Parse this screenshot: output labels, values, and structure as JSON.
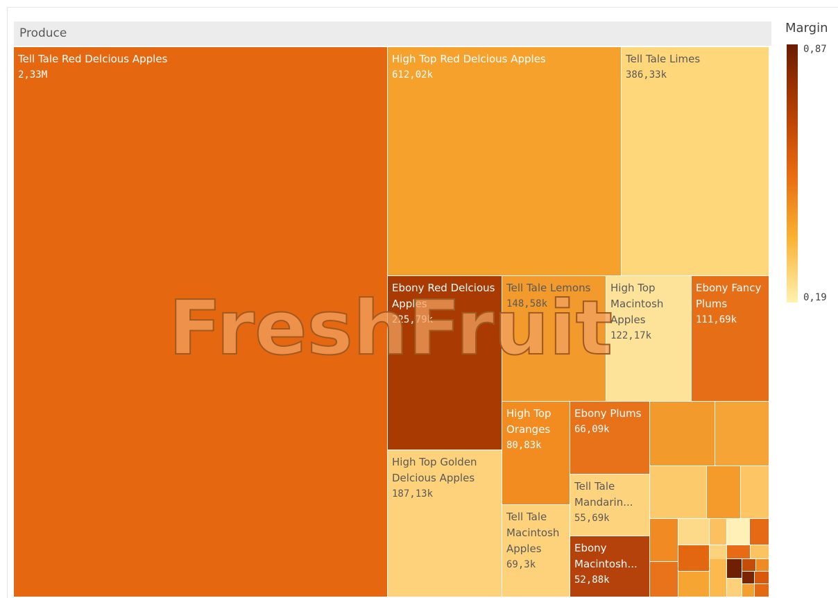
{
  "header": {
    "title": "Produce"
  },
  "legend": {
    "title": "Margin",
    "max_label": "0,87",
    "min_label": "0,19",
    "colors": [
      "#6b1c00",
      "#e86a10",
      "#fff2b0"
    ]
  },
  "watermark": {
    "text": "FreshFruit",
    "color": "#f0a060"
  },
  "chart_data": {
    "type": "treemap",
    "title": "Produce",
    "color_measure": "Margin",
    "color_range": [
      0.19,
      0.87
    ],
    "items": [
      {
        "name": "Tell Tale Red Delcious Apples",
        "value_label": "2,33M",
        "value": 2330000
      },
      {
        "name": "High Top Red Delcious Apples",
        "value_label": "612,02k",
        "value": 612020
      },
      {
        "name": "Tell Tale Limes",
        "value_label": "386,33k",
        "value": 386330
      },
      {
        "name": "Ebony Red Delcious Apples",
        "value_label": "225,79k",
        "value": 225790
      },
      {
        "name": "Tell Tale Lemons",
        "value_label": "148,58k",
        "value": 148580
      },
      {
        "name": "High Top Macintosh Apples",
        "value_label": "122,17k",
        "value": 122170
      },
      {
        "name": "Ebony Fancy Plums",
        "value_label": "111,69k",
        "value": 111690
      },
      {
        "name": "High Top Golden Delcious Apples",
        "value_label": "187,13k",
        "value": 187130
      },
      {
        "name": "High Top Oranges",
        "value_label": "80,83k",
        "value": 80830
      },
      {
        "name": "Ebony Plums",
        "value_label": "66,09k",
        "value": 66090
      },
      {
        "name": "Tell Tale Mandarin...",
        "value_label": "55,69k",
        "value": 55690
      },
      {
        "name": "Tell Tale Macintosh Apples",
        "value_label": "69,3k",
        "value": 69300
      },
      {
        "name": "Ebony Macintosh...",
        "value_label": "52,88k",
        "value": 52880
      }
    ]
  }
}
